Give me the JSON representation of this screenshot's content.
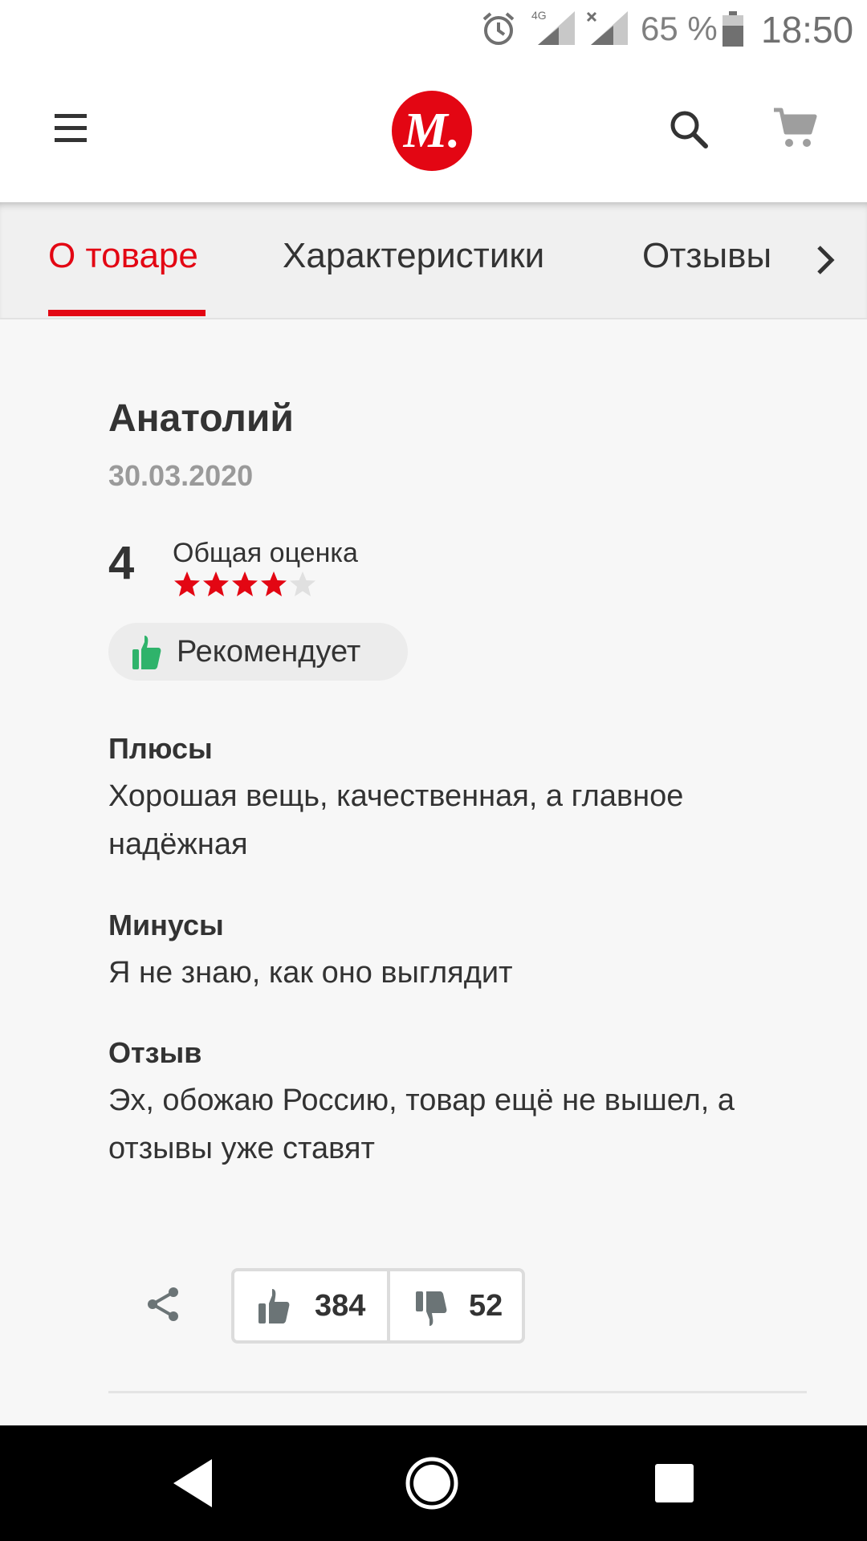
{
  "status_bar": {
    "network": "4G",
    "battery": "65 %",
    "time": "18:50"
  },
  "header": {
    "logo_text": "М.",
    "brand_color": "#e30613"
  },
  "tabs": [
    {
      "label": "О товаре",
      "active": true
    },
    {
      "label": "Характеристики",
      "active": false
    },
    {
      "label": "Отзывы",
      "active": false
    }
  ],
  "review": {
    "author": "Анатолий",
    "date": "30.03.2020",
    "rating": "4",
    "rating_label": "Общая оценка",
    "stars_filled": 4,
    "stars_total": 5,
    "recommend_label": "Рекомендует",
    "pros_title": "Плюсы",
    "pros_text": "Хорошая вещь, качественная, а главное надёжная",
    "cons_title": "Минусы",
    "cons_text": "Я не знаю, как оно выглядит",
    "comment_title": "Отзыв",
    "comment_text": "Эх, обожаю Россию, товар ещё не вышел, а отзывы уже ставят"
  },
  "votes": {
    "likes": "384",
    "dislikes": "52"
  },
  "colors": {
    "accent": "#e30613",
    "star_empty": "#e0e0e0",
    "recommend_icon": "#2fb36b",
    "vote_icon": "#6b7476"
  }
}
